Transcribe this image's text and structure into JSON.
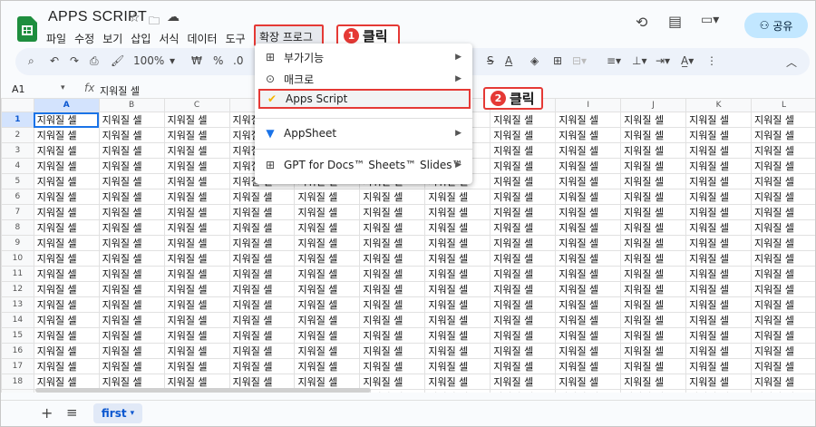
{
  "title": "APPS SCRIPT",
  "menu": [
    "파일",
    "수정",
    "보기",
    "삽입",
    "서식",
    "데이터",
    "도구"
  ],
  "ext_menu": "확장 프로그램",
  "callout1": {
    "num": "1",
    "text": "클릭"
  },
  "callout2": {
    "num": "2",
    "text": "클릭"
  },
  "share": "공유",
  "toolbar": {
    "zoom": "100%",
    "currency": "₩",
    "percent": "%",
    "decimal": ".0"
  },
  "namebox": "A1",
  "formula": "지워질 셀",
  "cell_text": "지워질 셀",
  "columns": [
    "A",
    "B",
    "C",
    "D",
    "E",
    "F",
    "G",
    "H",
    "I",
    "J",
    "K",
    "L"
  ],
  "row_count": 20,
  "dropdown": {
    "addons": "부가기능",
    "macros": "매크로",
    "apps_script": "Apps Script",
    "appsheet": "AppSheet",
    "gpt": "GPT for Docs™ Sheets™ Slides™"
  },
  "sheet_tab": "first"
}
